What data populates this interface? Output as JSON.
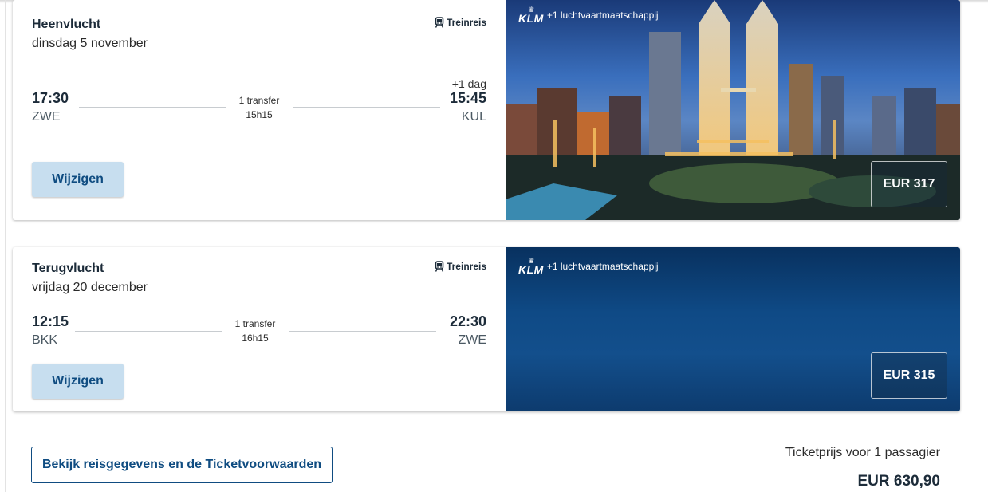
{
  "outbound": {
    "title": "Heenvlucht",
    "date": "dinsdag 5 november",
    "train_label": "Treinreis",
    "departure_time": "17:30",
    "departure_code": "ZWE",
    "arrival_time": "15:45",
    "arrival_code": "KUL",
    "next_day": "+1 dag",
    "transfers": "1 transfer",
    "duration": "15h15",
    "change_label": "Wijzigen",
    "airline_extra": "+1 luchtvaartmaatschappij",
    "airline_logo": "KLM",
    "price": "EUR 317",
    "image": "city-skyline-night"
  },
  "return": {
    "title": "Terugvlucht",
    "date": "vrijdag 20 december",
    "train_label": "Treinreis",
    "departure_time": "12:15",
    "departure_code": "BKK",
    "arrival_time": "22:30",
    "arrival_code": "ZWE",
    "transfers": "1 transfer",
    "duration": "16h15",
    "change_label": "Wijzigen",
    "airline_extra": "+1 luchtvaartmaatschappij",
    "airline_logo": "KLM",
    "price": "EUR 315"
  },
  "footer": {
    "details_link": "Bekijk reisgegevens en de Ticketvoorwaarden",
    "pax_label": "Ticketprijs voor 1 passagier",
    "total_price": "EUR 630,90"
  },
  "colors": {
    "brand_blue": "#0f4c81",
    "button_bg": "#c7deef",
    "panel_blue": "#0f4a86"
  }
}
